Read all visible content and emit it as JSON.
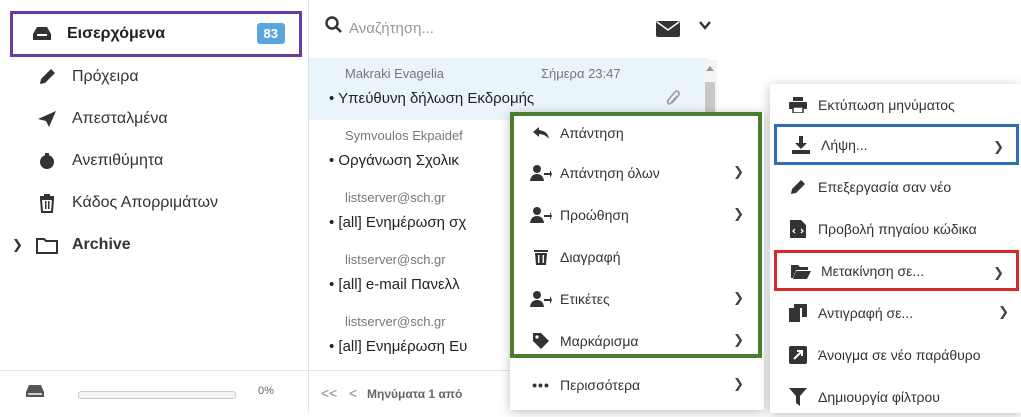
{
  "folders": {
    "inbox": {
      "label": "Εισερχόμενα",
      "count": "83"
    },
    "drafts": {
      "label": "Πρόχειρα"
    },
    "sent": {
      "label": "Απεσταλμένα"
    },
    "junk": {
      "label": "Ανεπιθύμητα"
    },
    "trash": {
      "label": "Κάδος Απορριμάτων"
    },
    "archive": {
      "label": "Archive"
    },
    "quota": {
      "percent_label": "0%",
      "fill": 0
    }
  },
  "search": {
    "placeholder": "Αναζήτηση..."
  },
  "messages": [
    {
      "from": "Makraki Evagelia",
      "date": "Σήμερα 23:47",
      "subject": "Υπεύθυνη δήλωση Εκδρομής",
      "attachment": true
    },
    {
      "from": "Symvoulos Ekpaidef",
      "date": "",
      "subject": "Οργάνωση Σχολικ",
      "attachment": false
    },
    {
      "from": "listserver@sch.gr",
      "date": "",
      "subject": "[all] Ενημέρωση σχ",
      "attachment": false
    },
    {
      "from": "listserver@sch.gr",
      "date": "",
      "subject": "[all] e-mail Πανελλ",
      "attachment": false
    },
    {
      "from": "listserver@sch.gr",
      "date": "",
      "subject": "[all] Ενημέρωση Ευ",
      "attachment": false
    }
  ],
  "pager": {
    "first": "<<",
    "prev": "<",
    "text": "Μηνύματα 1 από"
  },
  "menu1": [
    {
      "label": "Απάντηση",
      "icon": "reply-icon",
      "submenu": false
    },
    {
      "label": "Απάντηση όλων",
      "icon": "reply-all-icon",
      "submenu": true
    },
    {
      "label": "Προώθηση",
      "icon": "forward-icon",
      "submenu": true
    },
    {
      "label": "Διαγραφή",
      "icon": "trash-icon",
      "submenu": false
    },
    {
      "label": "Ετικέτες",
      "icon": "tags-icon",
      "submenu": true
    },
    {
      "label": "Μαρκάρισμα",
      "icon": "tag-icon",
      "submenu": true
    },
    {
      "label": "Περισσότερα",
      "icon": "more-icon",
      "submenu": true
    }
  ],
  "menu2": [
    {
      "label": "Εκτύπωση μηνύματος",
      "icon": "print-icon",
      "submenu": false
    },
    {
      "label": "Λήψη...",
      "icon": "download-icon",
      "submenu": true
    },
    {
      "label": "Επεξεργασία σαν νέο",
      "icon": "edit-icon",
      "submenu": false
    },
    {
      "label": "Προβολή πηγαίου κώδικα",
      "icon": "source-icon",
      "submenu": false
    },
    {
      "label": "Μετακίνηση σε...",
      "icon": "folder-move-icon",
      "submenu": true
    },
    {
      "label": "Αντιγραφή σε...",
      "icon": "copy-icon",
      "submenu": true
    },
    {
      "label": "Άνοιγμα σε νέο παράθυρο",
      "icon": "new-window-icon",
      "submenu": false
    },
    {
      "label": "Δημιουργία φίλτρου",
      "icon": "filter-icon",
      "submenu": false
    }
  ],
  "colors": {
    "inbox_border": "#6a3aa0",
    "menu1_border": "#4a7d2d",
    "download_border": "#2f6db5",
    "move_border": "#d72b2b",
    "badge": "#5aa6dc"
  }
}
